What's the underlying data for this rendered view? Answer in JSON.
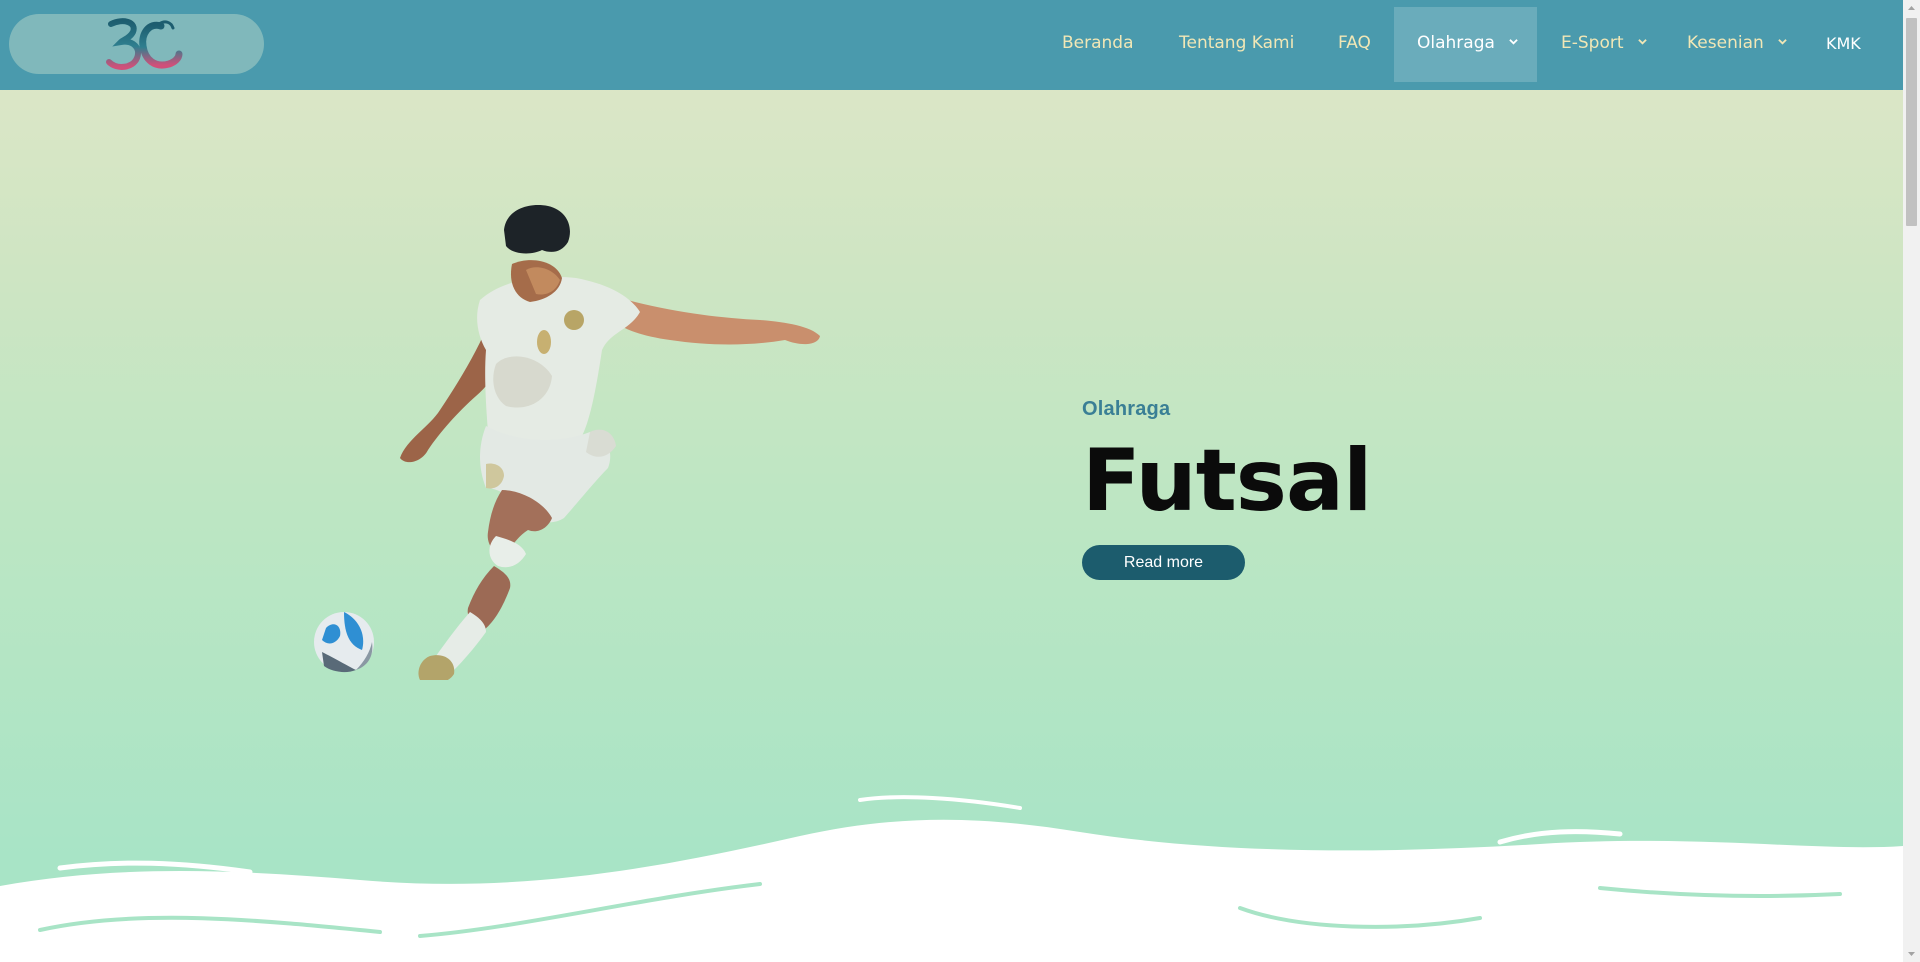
{
  "header": {
    "brand": "3C",
    "nav": [
      {
        "label": "Beranda"
      },
      {
        "label": "Tentang Kami"
      },
      {
        "label": "FAQ"
      },
      {
        "label": "Olahraga",
        "dropdown": true,
        "active": true
      },
      {
        "label": "E-Sport",
        "dropdown": true
      },
      {
        "label": "Kesenian",
        "dropdown": true
      },
      {
        "label": "KMK"
      }
    ]
  },
  "hero": {
    "eyebrow": "Olahraga",
    "title": "Futsal",
    "cta_label": "Read more"
  },
  "colors": {
    "header_bg": "#4a9aad",
    "nav_text": "#f1e7b6",
    "button_bg": "#1c5c6d",
    "eyebrow": "#3a7f95"
  },
  "icons": [
    "logo-3c-icon",
    "chevron-down-icon",
    "football-player-illustration",
    "soccer-ball-icon"
  ]
}
